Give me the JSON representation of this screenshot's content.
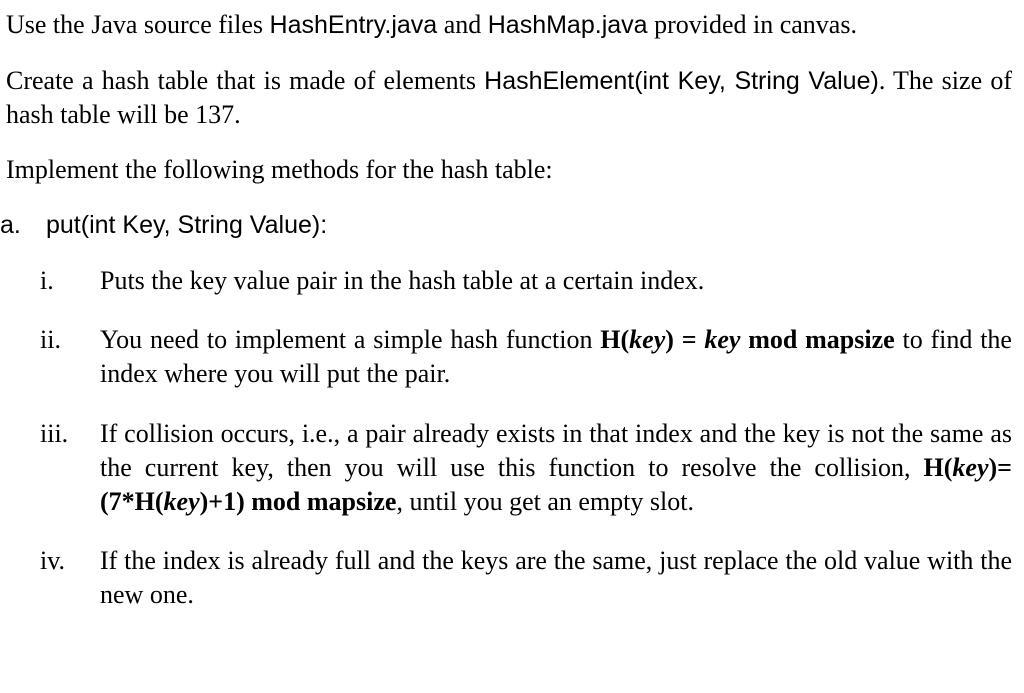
{
  "p1_pre": "Use the Java source files ",
  "p1_file1": "HashEntry.java",
  "p1_mid": " and ",
  "p1_file2": "HashMap.java",
  "p1_post": " provided in canvas.",
  "p2_pre": "Create a hash table that is made of elements ",
  "p2_code": "HashElement(int Key, String Value)",
  "p2_post": ". The size of hash table will be 137.",
  "p3": "Implement the following methods for the hash table:",
  "a_marker": "a.",
  "a_label": "put(int Key, String Value):",
  "i_marker": "i.",
  "i_text": "Puts the key value pair in the hash table at a certain index.",
  "ii_marker": "ii.",
  "ii_pre": "You need to implement a simple hash function ",
  "ii_hk": "H(",
  "ii_key1": "key",
  "ii_hk2": ") = ",
  "ii_key2": "key",
  "ii_mod": " mod mapsize",
  "ii_post": " to find the index where you will put the pair.",
  "iii_marker": "iii.",
  "iii_pre": "If collision occurs, i.e., a pair already exists in that index and the key is not the same as the current key, then you will use this function to resolve the collision, ",
  "iii_h1": "H(",
  "iii_k1": "key",
  "iii_h2": ")=(7*H(",
  "iii_k2": "key",
  "iii_h3": ")+1) mod mapsize",
  "iii_post": ", until you get an empty slot.",
  "iv_marker": "iv.",
  "iv_text": "If the index is already full and the keys are the same, just replace the old value with the new one."
}
